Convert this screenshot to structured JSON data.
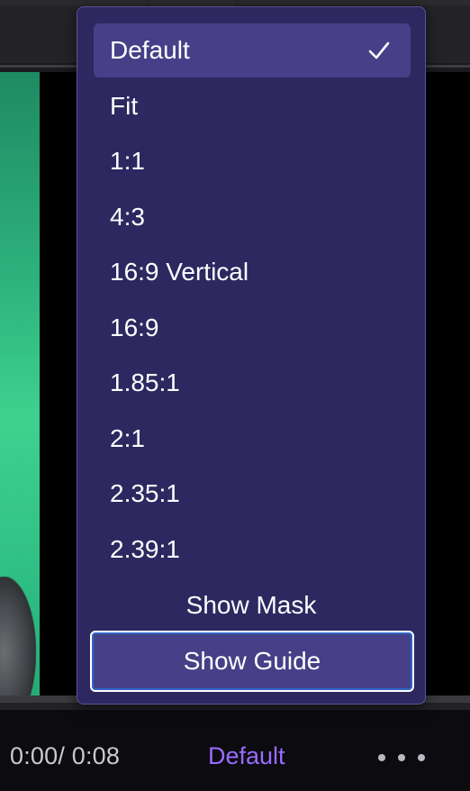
{
  "video": {
    "timecode": "0:00/ 0:08"
  },
  "controls": {
    "aspect_label": "Default",
    "more_icon": "more-horizontal-icon"
  },
  "aspect_menu": {
    "selected": "Default",
    "items": [
      {
        "label": "Default"
      },
      {
        "label": "Fit"
      },
      {
        "label": "1:1"
      },
      {
        "label": "4:3"
      },
      {
        "label": "16:9 Vertical"
      },
      {
        "label": "16:9"
      },
      {
        "label": "1.85:1"
      },
      {
        "label": "2:1"
      },
      {
        "label": "2.35:1"
      },
      {
        "label": "2.39:1"
      }
    ],
    "show_mask_label": "Show Mask",
    "show_guide_label": "Show Guide"
  },
  "colors": {
    "menu_bg": "#2d2860",
    "menu_selected": "#473f87",
    "accent_text": "#9b6bff",
    "focus_ring": "#2f66c9"
  }
}
